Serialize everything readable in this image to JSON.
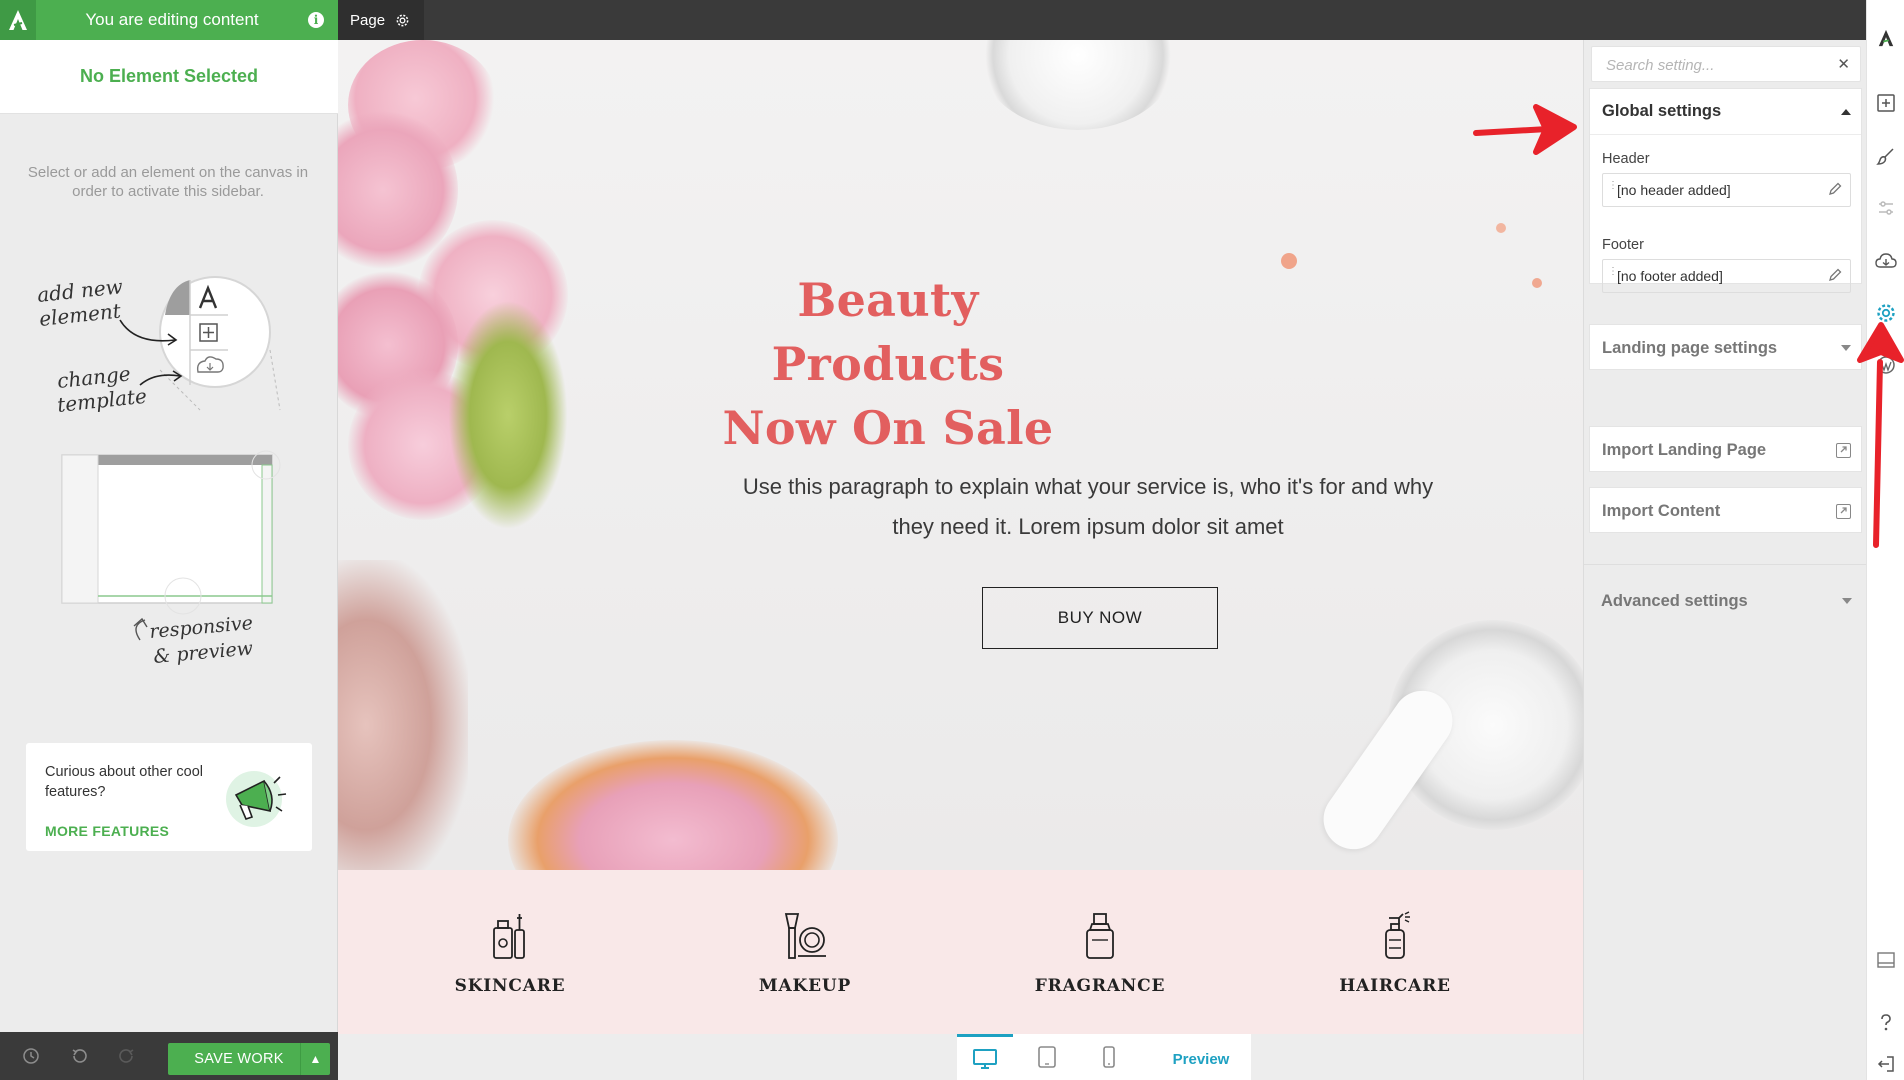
{
  "topbar": {
    "editing_label": "You are editing content",
    "page_tab_label": "Page"
  },
  "left_sidebar": {
    "no_element": "No Element Selected",
    "hint": "Select or add an element on the canvas in order to activate this sidebar.",
    "doodle": {
      "add_new_element": [
        "add new",
        "element"
      ],
      "change_template": [
        "change",
        "template"
      ],
      "responsive_preview": [
        "responsive",
        "& preview"
      ]
    },
    "promo": {
      "question": "Curious about other cool features?",
      "link": "MORE FEATURES"
    },
    "save_label": "SAVE WORK"
  },
  "canvas": {
    "hero_title_line1": "Beauty Products",
    "hero_title_line2": "Now On Sale",
    "hero_paragraph": "Use this paragraph to explain what your service is, who it's for and why they need it. Lorem ipsum dolor sit amet",
    "buy_button": "BUY NOW",
    "categories": [
      {
        "label": "SKINCARE",
        "icon": "skincare-icon"
      },
      {
        "label": "MAKEUP",
        "icon": "makeup-icon"
      },
      {
        "label": "FRAGRANCE",
        "icon": "fragrance-icon"
      },
      {
        "label": "HAIRCARE",
        "icon": "haircare-icon"
      }
    ]
  },
  "device_bar": {
    "devices": [
      "desktop",
      "tablet",
      "mobile"
    ],
    "active": "desktop",
    "preview_label": "Preview"
  },
  "right_panel": {
    "search_placeholder": "Search setting...",
    "global_settings": {
      "title": "Global settings",
      "header_label": "Header",
      "header_value": "[no header added]",
      "footer_label": "Footer",
      "footer_value": "[no footer added]"
    },
    "landing_page_settings": "Landing page settings",
    "import_landing_page": "Import Landing Page",
    "import_content": "Import Content",
    "advanced_settings": "Advanced settings"
  },
  "colors": {
    "brand_green": "#4caf50",
    "accent_blue": "#1ea1c2",
    "hero_title_red": "#e25f5f",
    "annotation_red": "#e8222a",
    "category_band": "#f9e8e8"
  }
}
